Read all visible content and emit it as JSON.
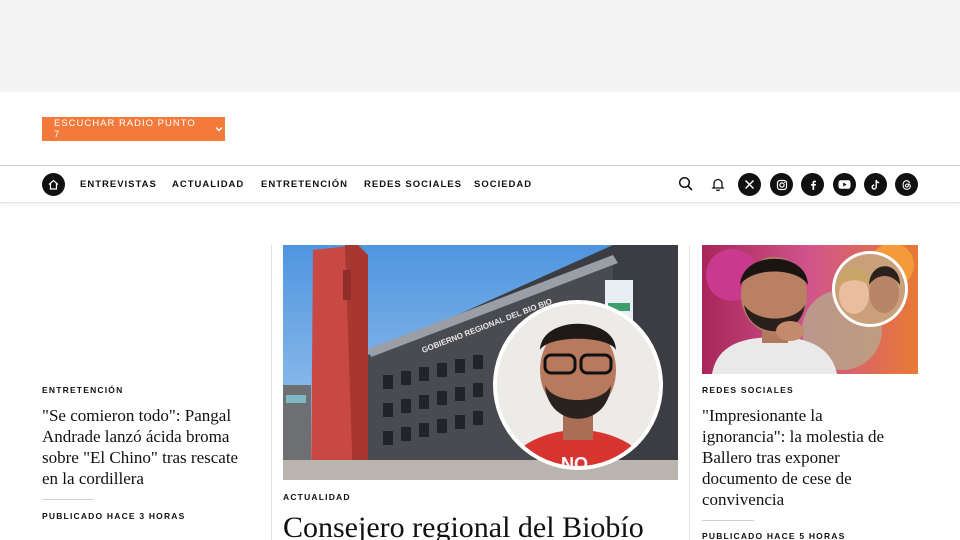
{
  "radio": {
    "label": "ESCUCHAR RADIO PUNTO 7"
  },
  "nav": {
    "links": [
      "ENTREVISTAS",
      "ACTUALIDAD",
      "ENTRETENCIÓN",
      "REDES SOCIALES",
      "SOCIEDAD"
    ],
    "social_icons": [
      "x-icon",
      "instagram-icon",
      "facebook-icon",
      "youtube-icon",
      "tiktok-icon",
      "threads-icon"
    ]
  },
  "image_text": {
    "building_sign": "GOBIERNO REGIONAL DEL BIO BIO",
    "shirt_text": "NO"
  },
  "articles": [
    {
      "kicker": "ENTRETENCIÓN",
      "title": "\"Se comieron todo\": Pangal Andrade lanzó ácida broma sobre \"El Chino\" tras rescate en la cordillera",
      "published": "PUBLICADO HACE 3 HORAS"
    },
    {
      "kicker": "ACTUALIDAD",
      "title": "Consejero regional del Biobío"
    },
    {
      "kicker": "REDES SOCIALES",
      "title": "\"Impresionante la ignorancia\": la molestia de Ballero tras exponer documento de cese de convivencia",
      "published": "PUBLICADO HACE 5 HORAS"
    }
  ],
  "colors": {
    "accent": "#f47a3c",
    "text": "#111111",
    "ad_band": "#f4f4f4"
  }
}
